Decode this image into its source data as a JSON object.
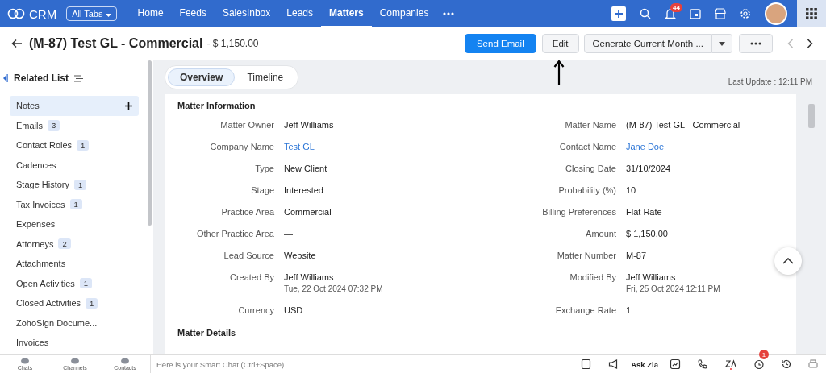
{
  "topbar": {
    "brand": "CRM",
    "all_tabs": "All Tabs",
    "nav": [
      {
        "label": "Home",
        "selected": false
      },
      {
        "label": "Feeds",
        "selected": false
      },
      {
        "label": "SalesInbox",
        "selected": false
      },
      {
        "label": "Leads",
        "selected": false
      },
      {
        "label": "Matters",
        "selected": true
      },
      {
        "label": "Companies",
        "selected": false
      }
    ],
    "notification_count": "44"
  },
  "header": {
    "title": "(M-87) Test GL - Commercial",
    "amount": "- $ 1,150.00",
    "send_email": "Send Email",
    "edit": "Edit",
    "generate": "Generate Current Month ..."
  },
  "annotation": {
    "kind": "arrow"
  },
  "sidebar": {
    "title": "Related List",
    "items": [
      {
        "label": "Notes",
        "selected": true
      },
      {
        "label": "Emails",
        "count": "3",
        "selected": false
      },
      {
        "label": "Contact Roles",
        "count": "1",
        "selected": false
      },
      {
        "label": "Cadences",
        "selected": false
      },
      {
        "label": "Stage History",
        "count": "1",
        "selected": false
      },
      {
        "label": "Tax Invoices",
        "count": "1",
        "selected": false
      },
      {
        "label": "Expenses",
        "selected": false
      },
      {
        "label": "Attorneys",
        "count": "2",
        "selected": false
      },
      {
        "label": "Attachments",
        "selected": false
      },
      {
        "label": "Open Activities",
        "count": "1",
        "selected": false
      },
      {
        "label": "Closed Activities",
        "count": "1",
        "selected": false
      },
      {
        "label": "ZohoSign Docume...",
        "selected": false
      },
      {
        "label": "Invoices",
        "selected": false
      }
    ]
  },
  "view_tabs": [
    {
      "label": "Overview",
      "selected": true
    },
    {
      "label": "Timeline",
      "selected": false
    }
  ],
  "last_update": "Last Update : 12:11 PM",
  "section": {
    "title": "Matter Information",
    "rows": [
      {
        "left": {
          "label": "Matter Owner",
          "value": "Jeff Williams",
          "kind": "text"
        },
        "right": {
          "label": "Matter Name",
          "value": "(M-87) Test GL - Commercial",
          "kind": "text"
        }
      },
      {
        "left": {
          "label": "Company Name",
          "value": "Test GL",
          "kind": "link"
        },
        "right": {
          "label": "Contact Name",
          "value": "Jane Doe",
          "kind": "link"
        }
      },
      {
        "left": {
          "label": "Type",
          "value": "New Client",
          "kind": "text"
        },
        "right": {
          "label": "Closing Date",
          "value": "31/10/2024",
          "kind": "text"
        }
      },
      {
        "left": {
          "label": "Stage",
          "value": "Interested",
          "kind": "text"
        },
        "right": {
          "label": "Probability (%)",
          "value": "10",
          "kind": "text"
        }
      },
      {
        "left": {
          "label": "Practice Area",
          "value": "Commercial",
          "kind": "text"
        },
        "right": {
          "label": "Billing Preferences",
          "value": "Flat Rate",
          "kind": "text"
        }
      },
      {
        "left": {
          "label": "Other Practice Area",
          "value": "—",
          "kind": "text"
        },
        "right": {
          "label": "Amount",
          "value": "$ 1,150.00",
          "kind": "text"
        }
      },
      {
        "left": {
          "label": "Lead Source",
          "value": "Website",
          "kind": "text"
        },
        "right": {
          "label": "Matter Number",
          "value": "M-87",
          "kind": "text"
        }
      },
      {
        "left": {
          "label": "Created By",
          "value": "Jeff Williams",
          "sub": "Tue, 22 Oct 2024 07:32 PM",
          "kind": "text"
        },
        "right": {
          "label": "Modified By",
          "value": "Jeff Williams",
          "sub": "Fri, 25 Oct 2024 12:11 PM",
          "kind": "text"
        }
      },
      {
        "left": {
          "label": "Currency",
          "value": "USD",
          "kind": "text"
        },
        "right": {
          "label": "Exchange Rate",
          "value": "1",
          "kind": "text"
        }
      }
    ]
  },
  "next_section": "Matter Details",
  "bottom_bar": {
    "apps": [
      "Chats",
      "Channels",
      "Contacts"
    ],
    "smart_chat_placeholder": "Here is your Smart Chat (Ctrl+Space)",
    "ask_zia": "Ask Zia",
    "reminder_count": "1"
  }
}
